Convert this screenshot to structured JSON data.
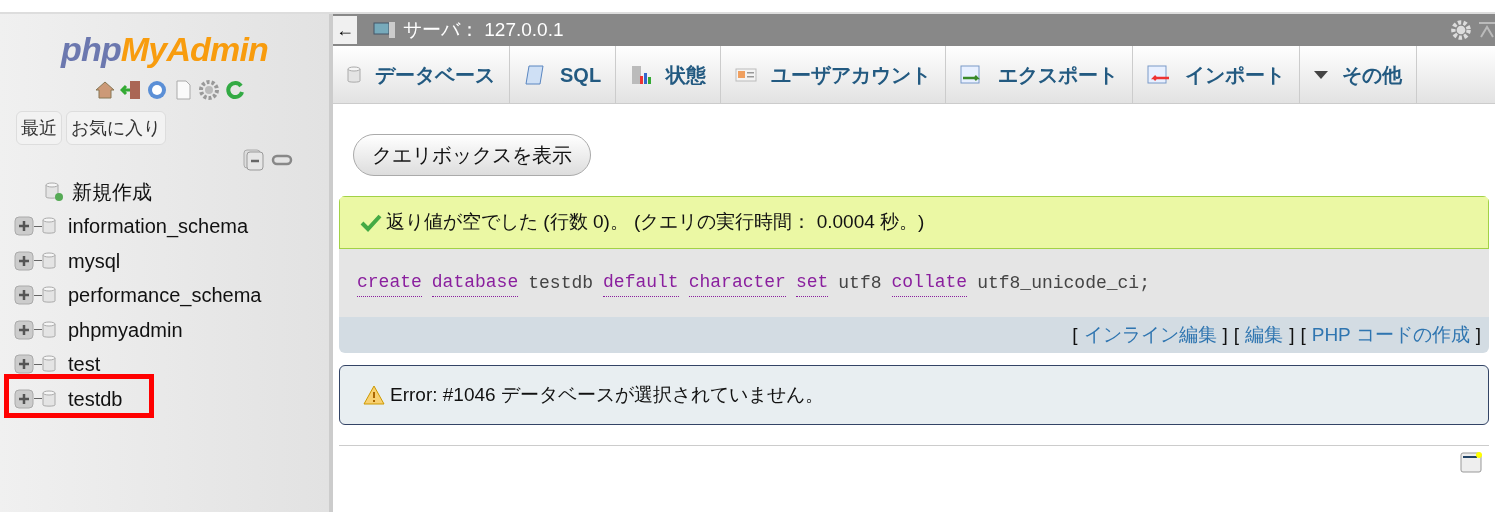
{
  "logo": {
    "part1": "php",
    "part2": "MyAdmin"
  },
  "sidebar_tabs": [
    {
      "label": "最近"
    },
    {
      "label": "お気に入り"
    }
  ],
  "tree": {
    "new_item": "新規作成",
    "databases": [
      {
        "name": "information_schema",
        "highlighted": false
      },
      {
        "name": "mysql",
        "highlighted": false
      },
      {
        "name": "performance_schema",
        "highlighted": false
      },
      {
        "name": "phpmyadmin",
        "highlighted": false
      },
      {
        "name": "test",
        "highlighted": false
      },
      {
        "name": "testdb",
        "highlighted": true
      }
    ]
  },
  "server_bar": {
    "back": "←",
    "title": "サーバ： 127.0.0.1"
  },
  "tabs": [
    {
      "label": "データベース",
      "kind": "database"
    },
    {
      "label": "SQL",
      "kind": "sql"
    },
    {
      "label": "状態",
      "kind": "status"
    },
    {
      "label": "ユーザアカウント",
      "kind": "user"
    },
    {
      "label": "エクスポート",
      "kind": "export"
    },
    {
      "label": "インポート",
      "kind": "import"
    },
    {
      "label": "その他",
      "kind": "more"
    }
  ],
  "query_box_button": "クエリボックスを表示",
  "success_message": "返り値が空でした (行数 0)。 (クエリの実行時間： 0.0004 秒。)",
  "sql_tokens": [
    {
      "text": "create",
      "kind": "keyword"
    },
    {
      "text": "database",
      "kind": "keyword"
    },
    {
      "text": "testdb",
      "kind": "plain"
    },
    {
      "text": "default",
      "kind": "keyword"
    },
    {
      "text": "character",
      "kind": "keyword"
    },
    {
      "text": "set",
      "kind": "keyword"
    },
    {
      "text": "utf8",
      "kind": "plain"
    },
    {
      "text": "collate",
      "kind": "keyword"
    },
    {
      "text": "utf8_unicode_ci;",
      "kind": "plain"
    }
  ],
  "actions": {
    "open": "[",
    "close": "]",
    "links": [
      "インライン編集",
      "編集",
      "PHP コードの作成"
    ]
  },
  "error_message": "Error: #1046 データベースが選択されていません。"
}
